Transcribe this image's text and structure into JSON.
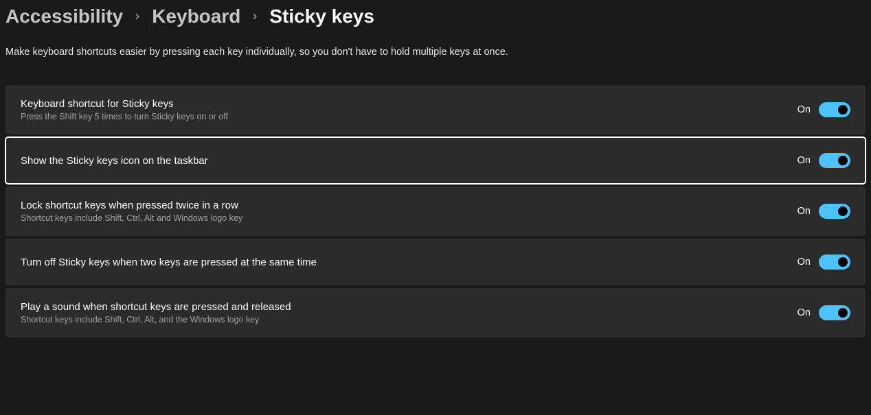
{
  "breadcrumb": {
    "items": [
      {
        "label": "Accessibility"
      },
      {
        "label": "Keyboard"
      },
      {
        "label": "Sticky keys"
      }
    ]
  },
  "description": "Make keyboard shortcuts easier by pressing each key individually, so you don't have to hold multiple keys at once.",
  "settings": [
    {
      "title": "Keyboard shortcut for Sticky keys",
      "subtitle": "Press the Shift key 5 times to turn Sticky keys on or off",
      "state_label": "On",
      "highlighted": false
    },
    {
      "title": "Show the Sticky keys icon on the taskbar",
      "subtitle": "",
      "state_label": "On",
      "highlighted": true
    },
    {
      "title": "Lock shortcut keys when pressed twice in a row",
      "subtitle": "Shortcut keys include Shift, Ctrl, Alt and Windows logo key",
      "state_label": "On",
      "highlighted": false
    },
    {
      "title": "Turn off Sticky keys when two keys are pressed at the same time",
      "subtitle": "",
      "state_label": "On",
      "highlighted": false
    },
    {
      "title": "Play a sound when shortcut keys are pressed and released",
      "subtitle": "Shortcut keys include Shift, Ctrl, Alt, and the Windows logo key",
      "state_label": "On",
      "highlighted": false
    }
  ]
}
